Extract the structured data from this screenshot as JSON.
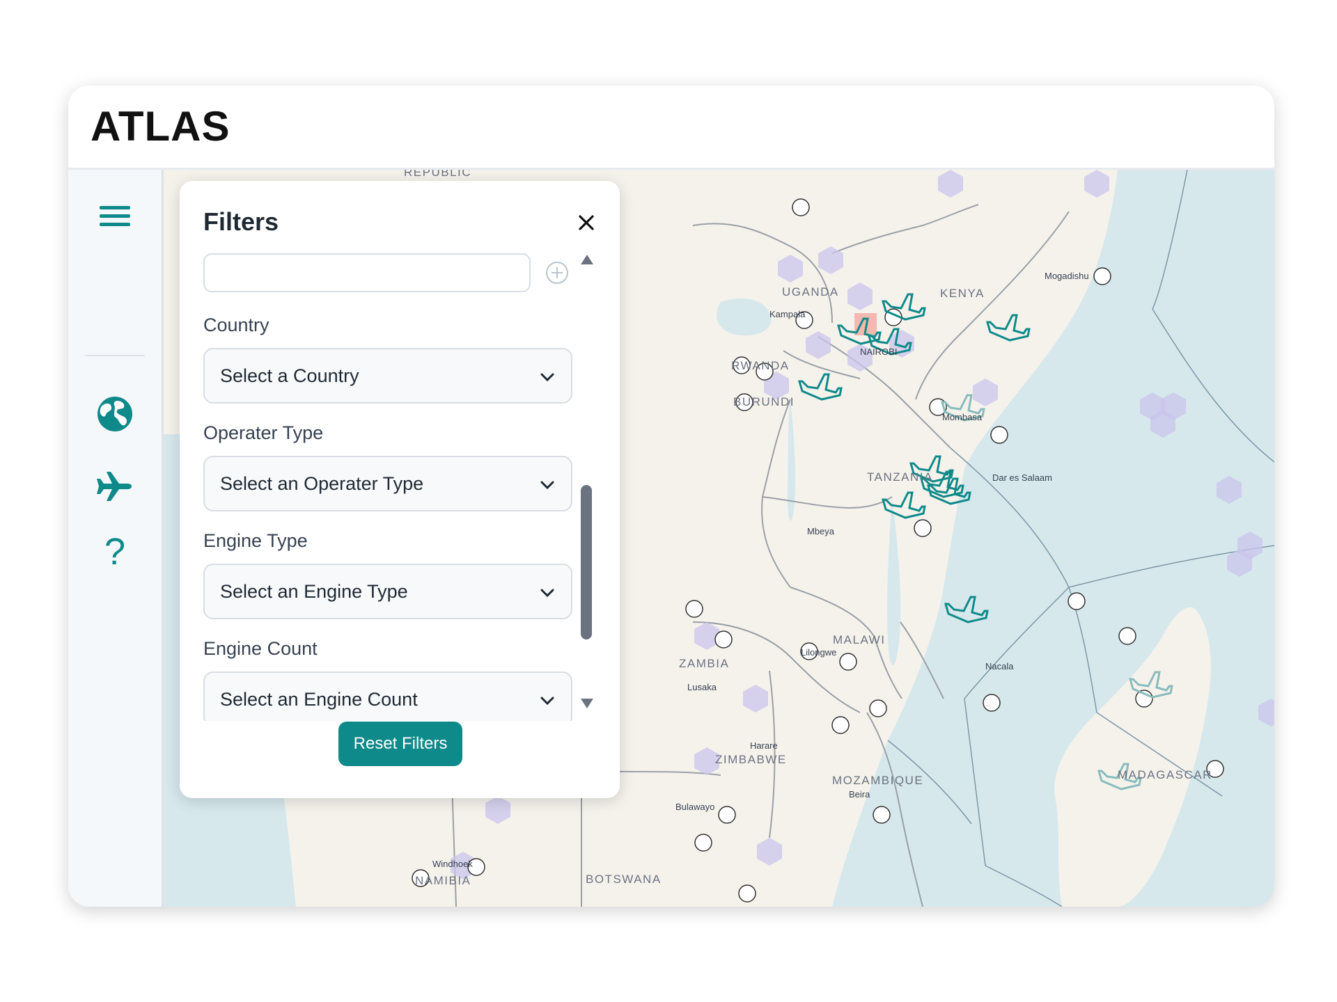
{
  "app": {
    "title": "ATLAS"
  },
  "sidebar": {
    "items": [
      {
        "icon": "hamburger-menu-icon"
      },
      {
        "icon": "globe-icon"
      },
      {
        "icon": "airplane-icon"
      },
      {
        "icon": "help-icon",
        "glyph": "?"
      }
    ],
    "accent_color": "#0f8a8a"
  },
  "filters": {
    "title": "Filters",
    "search_value": "",
    "fields": [
      {
        "label": "Country",
        "placeholder": "Select a Country"
      },
      {
        "label": "Operater Type",
        "placeholder": "Select an Operater Type"
      },
      {
        "label": "Engine Type",
        "placeholder": "Select an Engine Type"
      },
      {
        "label": "Engine Count",
        "placeholder": "Select an Engine Count"
      }
    ],
    "reset_label": "Reset Filters"
  },
  "map": {
    "countries": [
      "UGANDA",
      "KENYA",
      "TANZANIA",
      "RWANDA",
      "BURUNDI",
      "MALAWI",
      "ZAMBIA",
      "ZIMBABWE",
      "MOZAMBIQUE",
      "MADAGASCAR",
      "NAMIBIA",
      "BOTSWANA",
      "REPUBLIC"
    ],
    "cities": [
      "Kampala",
      "NAIROBI",
      "Mogadishu",
      "Mombasa",
      "Dar es Salaam",
      "Mbeya",
      "Lilongwe",
      "Nacala",
      "Harare",
      "Lusaka",
      "Beira",
      "Bulawayo",
      "Windhoek"
    ],
    "colors": {
      "water": "#d6e8ec",
      "land": "#f5f2ec",
      "aircraft": "#0f8a8a",
      "hex": "#c9c4ec"
    }
  }
}
